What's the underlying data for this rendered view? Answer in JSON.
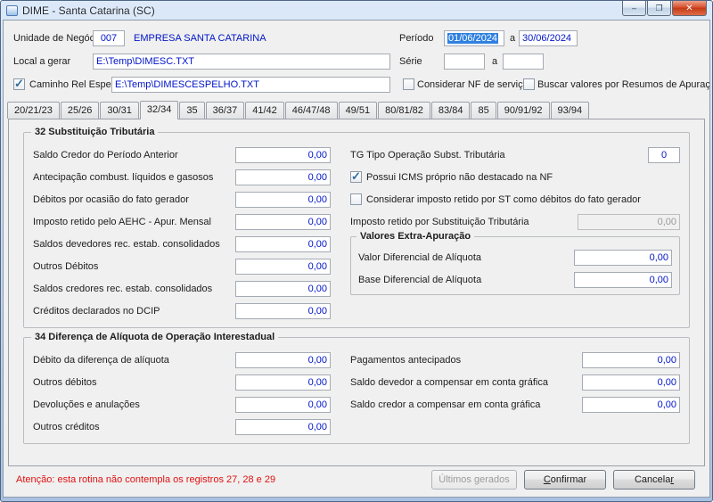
{
  "icons": {
    "checkmark": "✓",
    "minimize": "–",
    "maximize": "❐",
    "close": "✕"
  },
  "window": {
    "title": "DIME - Santa Catarina (SC)"
  },
  "header": {
    "unidade": {
      "label": "Unidade de Negócio",
      "code": "007",
      "name": "EMPRESA SANTA CATARINA"
    },
    "periodo": {
      "label": "Período",
      "start": "01/06/2024",
      "sep": "a",
      "end": "30/06/2024"
    },
    "local": {
      "label": "Local a gerar",
      "value": "E:\\Temp\\DIMESC.TXT"
    },
    "serie": {
      "label": "Série",
      "start": "",
      "sep": "a",
      "end": ""
    },
    "espelho": {
      "label": "Caminho Rel Espelho",
      "value": "E:\\Temp\\DIMESCESPELHO.TXT",
      "checked": true
    },
    "nf_servico": {
      "label": "Considerar NF de serviço",
      "checked": false
    },
    "resumos": {
      "label": "Buscar valores por Resumos de Apuração",
      "checked": false
    }
  },
  "tabs": {
    "items": [
      "20/21/23",
      "25/26",
      "30/31",
      "32/34",
      "35",
      "36/37",
      "41/42",
      "46/47/48",
      "49/51",
      "80/81/82",
      "83/84",
      "85",
      "90/91/92",
      "93/94"
    ],
    "active": "32/34"
  },
  "group32": {
    "title": "32 Substituição Tributária",
    "fields": [
      {
        "label": "Saldo Credor do Período Anterior",
        "value": "0,00"
      },
      {
        "label": "Antecipação combust. líquidos e gasosos",
        "value": "0,00"
      },
      {
        "label": "Débitos por ocasião do fato gerador",
        "value": "0,00"
      },
      {
        "label": "Imposto retido pelo AEHC - Apur. Mensal",
        "value": "0,00"
      },
      {
        "label": "Saldos devedores rec. estab. consolidados",
        "value": "0,00"
      },
      {
        "label": "Outros Débitos",
        "value": "0,00"
      },
      {
        "label": "Saldos credores rec. estab. consolidados",
        "value": "0,00"
      },
      {
        "label": "Créditos declarados no DCIP",
        "value": "0,00"
      }
    ],
    "tg": {
      "label": "TG Tipo Operação Subst. Tributária",
      "value": "0"
    },
    "check_icms": {
      "label": "Possui ICMS próprio não destacado na NF",
      "checked": true
    },
    "check_st": {
      "label": "Considerar imposto retido por ST como débitos do fato gerador",
      "checked": false
    },
    "imposto_retido": {
      "label": "Imposto retido por Substituição Tributária",
      "value": "0,00",
      "disabled": true
    },
    "extra": {
      "title": "Valores Extra-Apuração",
      "fields": [
        {
          "label": "Valor Diferencial de Alíquota",
          "value": "0,00"
        },
        {
          "label": "Base Diferencial de Alíquota",
          "value": "0,00"
        }
      ]
    }
  },
  "group34": {
    "title": "34 Diferença de Alíquota de Operação Interestadual",
    "left_fields": [
      {
        "label": "Débito da diferença de alíquota",
        "value": "0,00"
      },
      {
        "label": "Outros débitos",
        "value": "0,00"
      },
      {
        "label": "Devoluções e anulações",
        "value": "0,00"
      },
      {
        "label": "Outros créditos",
        "value": "0,00"
      }
    ],
    "right_fields": [
      {
        "label": "Pagamentos antecipados",
        "value": "0,00"
      },
      {
        "label": "Saldo devedor a compensar em conta gráfica",
        "value": "0,00"
      },
      {
        "label": "Saldo credor a compensar em conta gráfica",
        "value": "0,00"
      }
    ]
  },
  "footer": {
    "warning": "Atenção: esta rotina não contempla os registros 27, 28 e 29",
    "ultimos_label": "Últimos gerados",
    "confirmar": {
      "accel": "C",
      "rest": "onfirmar"
    },
    "cancelar": {
      "pre": "Cancela",
      "accel": "r"
    }
  }
}
